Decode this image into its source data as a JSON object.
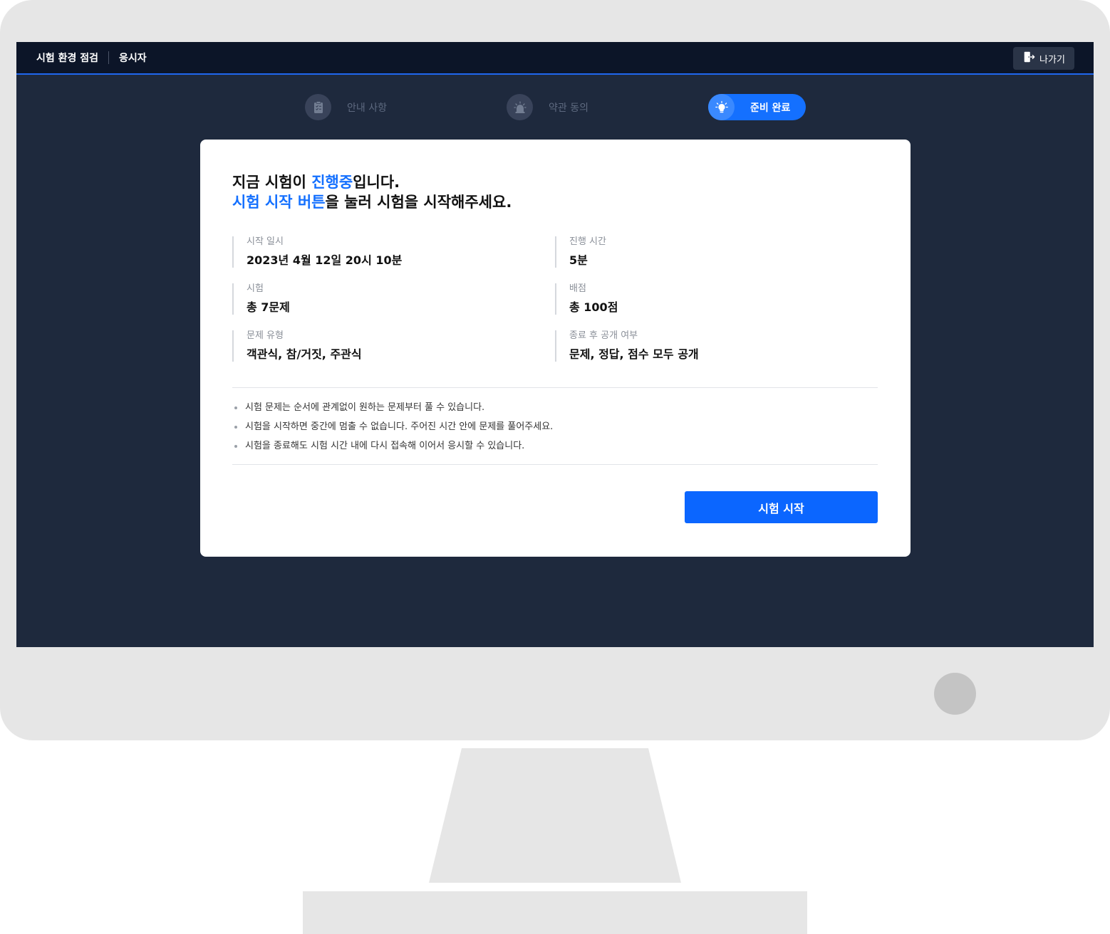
{
  "header": {
    "title": "시험 환경 점검",
    "role": "응시자",
    "exit_label": "나가기",
    "exit_icon": "exit-door-icon"
  },
  "steps": [
    {
      "label": "안내 사항",
      "icon": "clipboard-icon",
      "active": false
    },
    {
      "label": "약관 동의",
      "icon": "siren-icon",
      "active": false
    },
    {
      "label": "준비 완료",
      "icon": "lightbulb-icon",
      "active": true
    }
  ],
  "card": {
    "headline_line1_prefix": "지금 시험이 ",
    "headline_line1_highlight": "진행중",
    "headline_line1_suffix": "입니다.",
    "headline_line2_highlight": "시험 시작 버튼",
    "headline_line2_suffix": "을 눌러 시험을 시작해주세요.",
    "info": [
      {
        "label": "시작 일시",
        "value": "2023년 4월 12일 20시 10분"
      },
      {
        "label": "진행 시간",
        "value": "5분"
      },
      {
        "label": "시험",
        "value": "총 7문제"
      },
      {
        "label": "배점",
        "value": "총 100점"
      },
      {
        "label": "문제 유형",
        "value": "객관식, 참/거짓, 주관식"
      },
      {
        "label": "종료 후 공개 여부",
        "value": "문제, 정답, 점수 모두 공개"
      }
    ],
    "notes": [
      "시험 문제는 순서에 관계없이 원하는 문제부터 풀 수 있습니다.",
      "시험을 시작하면 중간에 멈출 수 없습니다. 주어진 시간 안에 문제를 풀어주세요.",
      "시험을 종료해도 시험 시간 내에 다시 접속해 이어서 응시할 수 있습니다."
    ],
    "start_button_label": "시험 시작"
  },
  "colors": {
    "accent": "#1470ff",
    "screen_bg": "#1e293d",
    "topbar_bg": "#0c1528"
  }
}
